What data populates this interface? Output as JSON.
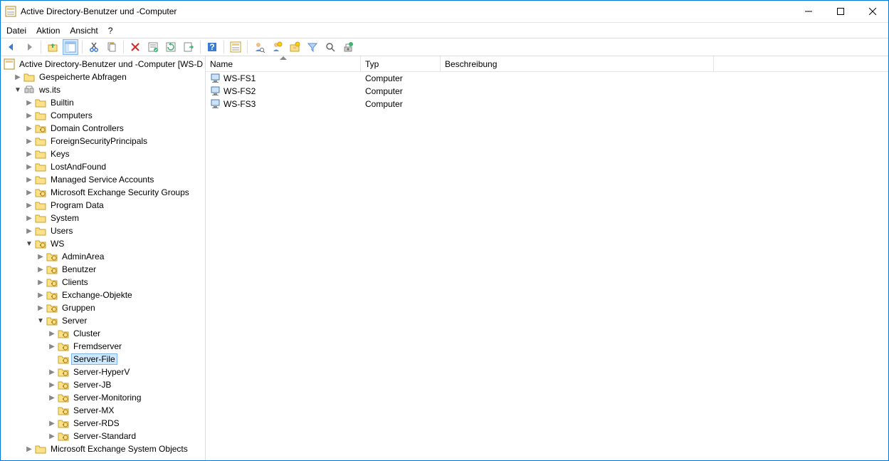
{
  "window": {
    "title": "Active Directory-Benutzer und -Computer"
  },
  "menu": {
    "file": "Datei",
    "action": "Aktion",
    "view": "Ansicht",
    "help": "?"
  },
  "tree": {
    "root": "Active Directory-Benutzer und -Computer [WS-D",
    "saved_queries": "Gespeicherte Abfragen",
    "domain": "ws.its",
    "builtin": "Builtin",
    "computers": "Computers",
    "domain_controllers": "Domain Controllers",
    "foreign_sec": "ForeignSecurityPrincipals",
    "keys": "Keys",
    "lost_found": "LostAndFound",
    "msa": "Managed Service Accounts",
    "exch_sec": "Microsoft Exchange Security Groups",
    "program_data": "Program Data",
    "system": "System",
    "users": "Users",
    "ws": "WS",
    "admin_area": "AdminArea",
    "benutzer": "Benutzer",
    "clients": "Clients",
    "exch_obj": "Exchange-Objekte",
    "gruppen": "Gruppen",
    "server": "Server",
    "cluster": "Cluster",
    "fremdserver": "Fremdserver",
    "server_file": "Server-File",
    "server_hyperv": "Server-HyperV",
    "server_jb": "Server-JB",
    "server_monitoring": "Server-Monitoring",
    "server_mx": "Server-MX",
    "server_rds": "Server-RDS",
    "server_standard": "Server-Standard",
    "exch_sys": "Microsoft Exchange System Objects"
  },
  "columns": {
    "name": "Name",
    "type": "Typ",
    "desc": "Beschreibung"
  },
  "rows": [
    {
      "name": "WS-FS1",
      "type": "Computer",
      "desc": ""
    },
    {
      "name": "WS-FS2",
      "type": "Computer",
      "desc": ""
    },
    {
      "name": "WS-FS3",
      "type": "Computer",
      "desc": ""
    }
  ]
}
